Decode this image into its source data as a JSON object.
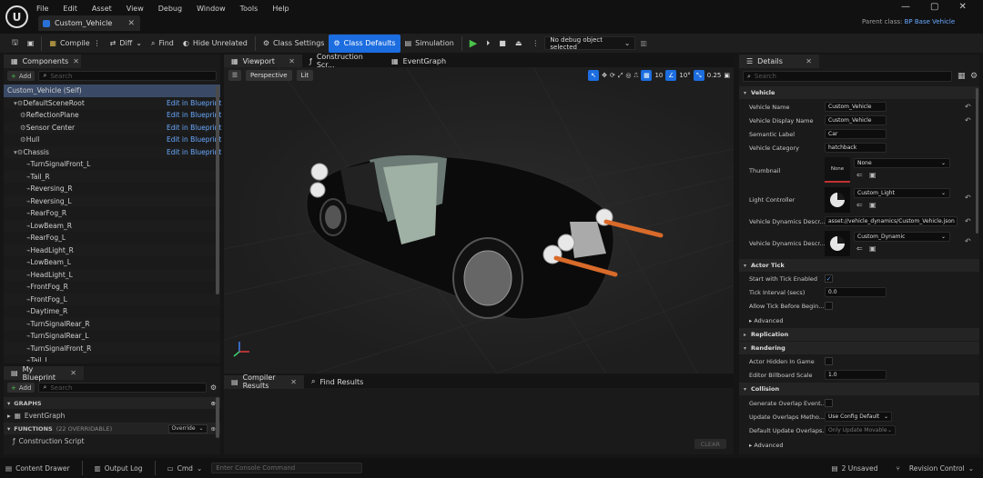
{
  "menu": [
    "File",
    "Edit",
    "Asset",
    "View",
    "Debug",
    "Window",
    "Tools",
    "Help"
  ],
  "doc_tab": "Custom_Vehicle",
  "parent_class_label": "Parent class:",
  "parent_class_value": "BP Base Vehicle",
  "toolbar": {
    "compile": "Compile",
    "diff": "Diff",
    "find": "Find",
    "hide_unrelated": "Hide Unrelated",
    "class_settings": "Class Settings",
    "class_defaults": "Class Defaults",
    "simulation": "Simulation",
    "debug_select": "No debug object selected"
  },
  "components": {
    "tab": "Components",
    "add": "Add",
    "search_placeholder": "Search",
    "items": [
      {
        "label": "Custom_Vehicle (Self)",
        "indent": 0,
        "edit": ""
      },
      {
        "label": "DefaultSceneRoot",
        "indent": 1,
        "edit": "Edit in Blueprint"
      },
      {
        "label": "ReflectionPlane",
        "indent": 2,
        "edit": "Edit in Blueprint"
      },
      {
        "label": "Sensor Center",
        "indent": 2,
        "edit": "Edit in Blueprint"
      },
      {
        "label": "Hull",
        "indent": 2,
        "edit": "Edit in Blueprint"
      },
      {
        "label": "Chassis",
        "indent": 1,
        "edit": "Edit in Blueprint"
      },
      {
        "label": "TurnSignalFront_L",
        "indent": 3,
        "edit": ""
      },
      {
        "label": "Tail_R",
        "indent": 3,
        "edit": ""
      },
      {
        "label": "Reversing_R",
        "indent": 3,
        "edit": ""
      },
      {
        "label": "Reversing_L",
        "indent": 3,
        "edit": ""
      },
      {
        "label": "RearFog_R",
        "indent": 3,
        "edit": ""
      },
      {
        "label": "LowBeam_R",
        "indent": 3,
        "edit": ""
      },
      {
        "label": "RearFog_L",
        "indent": 3,
        "edit": ""
      },
      {
        "label": "HeadLight_R",
        "indent": 3,
        "edit": ""
      },
      {
        "label": "LowBeam_L",
        "indent": 3,
        "edit": ""
      },
      {
        "label": "HeadLight_L",
        "indent": 3,
        "edit": ""
      },
      {
        "label": "FrontFog_R",
        "indent": 3,
        "edit": ""
      },
      {
        "label": "FrontFog_L",
        "indent": 3,
        "edit": ""
      },
      {
        "label": "Daytime_R",
        "indent": 3,
        "edit": ""
      },
      {
        "label": "TurnSignalRear_R",
        "indent": 3,
        "edit": ""
      },
      {
        "label": "TurnSignalRear_L",
        "indent": 3,
        "edit": ""
      },
      {
        "label": "TurnSignalFront_R",
        "indent": 3,
        "edit": ""
      },
      {
        "label": "Tail_L",
        "indent": 3,
        "edit": ""
      }
    ]
  },
  "myblueprint": {
    "tab": "My Blueprint",
    "add": "Add",
    "search_placeholder": "Search",
    "graphs": "GRAPHS",
    "event_graph": "EventGraph",
    "functions": "FUNCTIONS",
    "functions_count": "(22 OVERRIDABLE)",
    "override": "Override",
    "construction": "Construction Script"
  },
  "center_tabs": [
    "Viewport",
    "Construction Scr...",
    "EventGraph"
  ],
  "viewport": {
    "perspective": "Perspective",
    "lit": "Lit",
    "grid": "10",
    "angle": "10°",
    "scale": "0.25"
  },
  "bottom_tabs": [
    "Compiler Results",
    "Find Results"
  ],
  "clear": "CLEAR",
  "details": {
    "tab": "Details",
    "search_placeholder": "Search",
    "sections": {
      "vehicle": "Vehicle",
      "actor_tick": "Actor Tick",
      "advanced": "Advanced",
      "replication": "Replication",
      "rendering": "Rendering",
      "collision": "Collision",
      "advanced2": "Advanced"
    },
    "labels": {
      "vehicle_name": "Vehicle Name",
      "display_name": "Vehicle Display Name",
      "semantic": "Semantic Label",
      "category": "Vehicle Category",
      "thumbnail": "Thumbnail",
      "light_ctrl": "Light Controller",
      "dyn1": "Vehicle Dynamics Descr...",
      "dyn2": "Vehicle Dynamics Descr...",
      "start_tick": "Start with Tick Enabled",
      "tick_interval": "Tick Interval (secs)",
      "allow_tick": "Allow Tick Before Begin...",
      "hidden": "Actor Hidden In Game",
      "billboard": "Editor Billboard Scale",
      "gen_overlap": "Generate Overlap Event...",
      "upd_overlap": "Update Overlaps Metho...",
      "def_overlap": "Default Update Overlaps..."
    },
    "values": {
      "vehicle_name": "Custom_Vehicle",
      "display_name": "Custom_Vehicle",
      "semantic": "Car",
      "category": "hatchback",
      "thumb_none": "None",
      "thumb_combo": "None",
      "light_combo": "Custom_Light",
      "dyn1": "asset://vehicle_dynamics/Custom_Vehicle.json",
      "dyn2": "Custom_Dynamic",
      "tick_interval": "0.0",
      "billboard": "1.0",
      "upd_overlap": "Use Config Default",
      "def_overlap": "Only Update Movable"
    }
  },
  "status": {
    "content_drawer": "Content Drawer",
    "output_log": "Output Log",
    "cmd": "Cmd",
    "console_placeholder": "Enter Console Command",
    "unsaved": "2 Unsaved",
    "revision": "Revision Control"
  }
}
